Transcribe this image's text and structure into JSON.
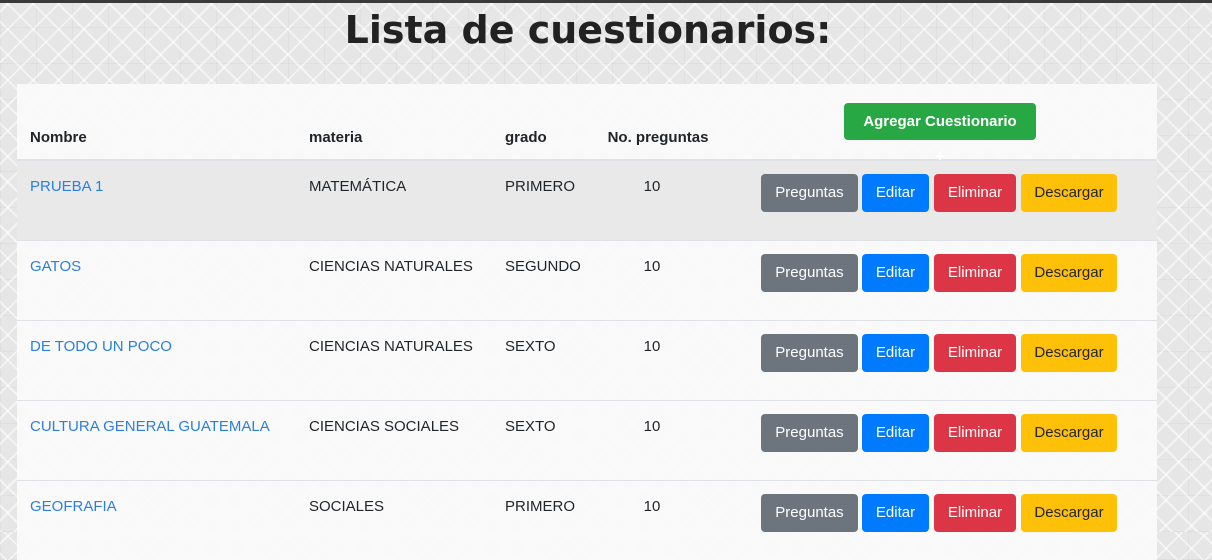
{
  "page": {
    "title": "Lista de cuestionarios:"
  },
  "table": {
    "headers": {
      "nombre": "Nombre",
      "materia": "materia",
      "grado": "grado",
      "preguntas": "No. preguntas"
    },
    "add_button": "Agregar Cuestionario +",
    "actions": {
      "preguntas": "Preguntas",
      "editar": "Editar",
      "eliminar": "Eliminar",
      "descargar": "Descargar"
    },
    "rows": [
      {
        "nombre": "PRUEBA 1",
        "materia": "MATEMÁTICA",
        "grado": "PRIMERO",
        "preguntas": "10"
      },
      {
        "nombre": "GATOS",
        "materia": "CIENCIAS NATURALES",
        "grado": "SEGUNDO",
        "preguntas": "10"
      },
      {
        "nombre": "DE TODO UN POCO",
        "materia": "CIENCIAS NATURALES",
        "grado": "SEXTO",
        "preguntas": "10"
      },
      {
        "nombre": "CULTURA GENERAL GUATEMALA",
        "materia": "CIENCIAS SOCIALES",
        "grado": "SEXTO",
        "preguntas": "10"
      },
      {
        "nombre": "GEOFRAFIA",
        "materia": "SOCIALES",
        "grado": "PRIMERO",
        "preguntas": "10"
      }
    ]
  },
  "colors": {
    "link": "#2b7fe0",
    "secondary": "#6c757d",
    "primary": "#007bff",
    "danger": "#dc3545",
    "warning": "#ffc107",
    "success": "#28a745"
  }
}
